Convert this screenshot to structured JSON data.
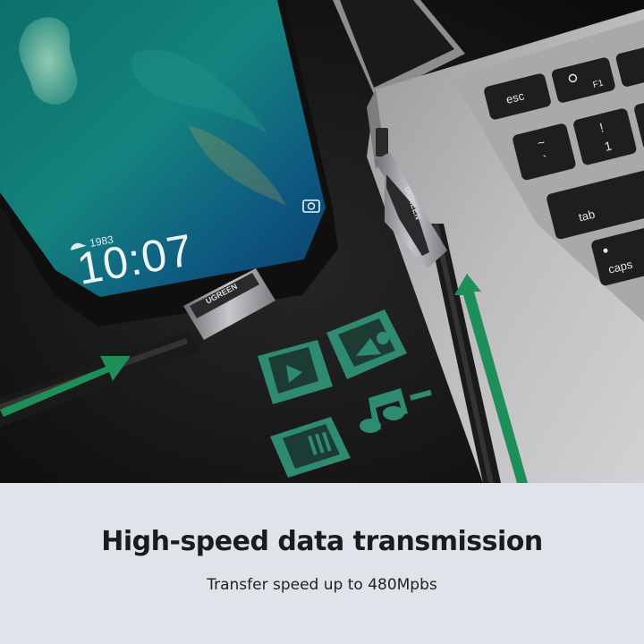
{
  "phone": {
    "date": "1983",
    "time": "10:07"
  },
  "keyboard": {
    "keys": {
      "esc": "esc",
      "f1": "F1",
      "tilde": "~",
      "backtick": "`",
      "one": "1",
      "exclaim": "!",
      "tab": "tab",
      "caps": "caps"
    }
  },
  "brand": {
    "connector_label": "UGREEN"
  },
  "icons": [
    "video-file-icon",
    "image-file-icon",
    "music-note-icon",
    "document-file-icon",
    "camera-icon",
    "brightness-icon"
  ],
  "colors": {
    "accent_green": "#1f8f5a",
    "icon_teal": "#2f8a72",
    "background_dark": "#141414",
    "caption_bg": "#dfe3ea"
  },
  "caption": {
    "headline": "High-speed data transmission",
    "subline": "Transfer speed up to 480Mpbs"
  }
}
